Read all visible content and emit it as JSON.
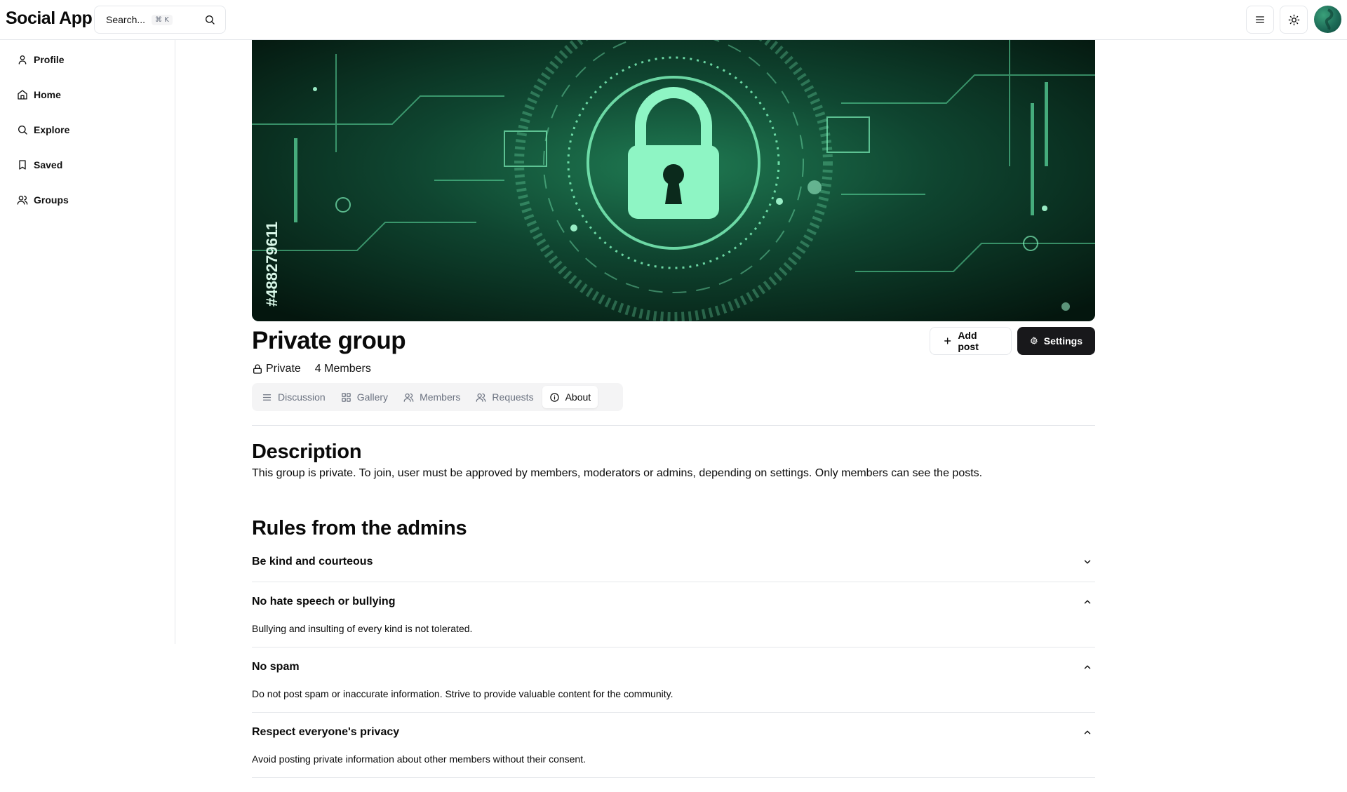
{
  "app": {
    "title": "Social App"
  },
  "search": {
    "placeholder": "Search...",
    "shortcut": "⌘ K"
  },
  "sidebar": {
    "items": [
      {
        "label": "Profile",
        "icon": "user-icon"
      },
      {
        "label": "Home",
        "icon": "home-icon"
      },
      {
        "label": "Explore",
        "icon": "search-icon"
      },
      {
        "label": "Saved",
        "icon": "bookmark-icon"
      },
      {
        "label": "Groups",
        "icon": "users-icon"
      }
    ]
  },
  "cover": {
    "image_text": "#488279611"
  },
  "group": {
    "name": "Private group",
    "privacy": "Private",
    "members": "4 Members"
  },
  "actions": {
    "add_post": "Add post",
    "settings": "Settings"
  },
  "tabs": [
    {
      "label": "Discussion",
      "icon": "list-icon",
      "active": false
    },
    {
      "label": "Gallery",
      "icon": "grid-icon",
      "active": false
    },
    {
      "label": "Members",
      "icon": "users-icon",
      "active": false
    },
    {
      "label": "Requests",
      "icon": "users-icon",
      "active": false
    },
    {
      "label": "About",
      "icon": "info-icon",
      "active": true
    }
  ],
  "about": {
    "description_heading": "Description",
    "description": "This group is private. To join, user must be approved by members, moderators or admins, depending on settings. Only members can see the posts.",
    "rules_heading": "Rules from the admins",
    "rules": [
      {
        "title": "Be kind and courteous",
        "expanded": false,
        "body": ""
      },
      {
        "title": "No hate speech or bullying",
        "expanded": true,
        "body": "Bullying and insulting of every kind is not tolerated."
      },
      {
        "title": "No spam",
        "expanded": true,
        "body": "Do not post spam or inaccurate information. Strive to provide valuable content for the community."
      },
      {
        "title": "Respect everyone's privacy",
        "expanded": true,
        "body": "Avoid posting private information about other members without their consent."
      }
    ]
  },
  "colors": {
    "primary": "#18181b",
    "border": "#e5e7eb",
    "muted": "#6b7280",
    "tab_bg": "#f4f4f5",
    "cover_green": "#7cf0b8"
  }
}
